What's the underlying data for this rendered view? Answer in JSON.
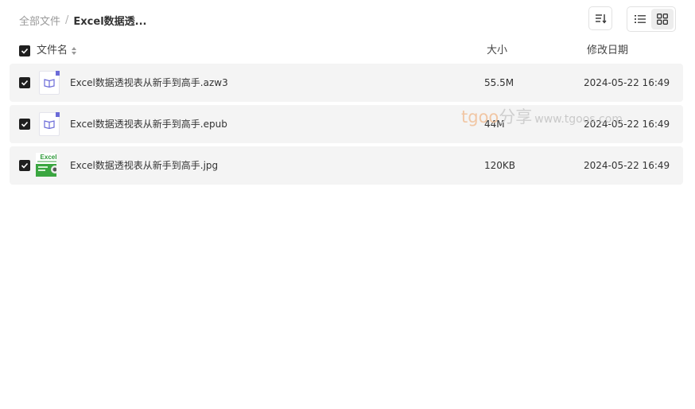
{
  "breadcrumb": {
    "root": "全部文件",
    "separator": "/",
    "current": "Excel数据透..."
  },
  "toolbar": {
    "sort_icon": "sort-icon",
    "list_view_icon": "list-view-icon",
    "grid_view_icon": "grid-view-icon"
  },
  "columns": {
    "name": "文件名",
    "size": "大小",
    "date": "修改日期"
  },
  "files": [
    {
      "name": "Excel数据透视表从新手到高手.azw3",
      "size": "55.5M",
      "date": "2024-05-22 16:49",
      "icon": "ebook-file-icon",
      "checked": true
    },
    {
      "name": "Excel数据透视表从新手到高手.epub",
      "size": "44M",
      "date": "2024-05-22 16:49",
      "icon": "ebook-file-icon",
      "checked": true
    },
    {
      "name": "Excel数据透视表从新手到高手.jpg",
      "size": "120KB",
      "date": "2024-05-22 16:49",
      "icon": "image-thumbnail",
      "checked": true
    }
  ],
  "thumbnail": {
    "title": "Excel"
  },
  "watermark": {
    "brand": "tgoo",
    "cn": "分享",
    "site": "www.tgoos.com"
  },
  "colors": {
    "row_bg": "#f4f4f4",
    "checkbox": "#1f1f1f",
    "ebook_accent": "#6b6bd8",
    "thumb_green": "#3aa640"
  }
}
